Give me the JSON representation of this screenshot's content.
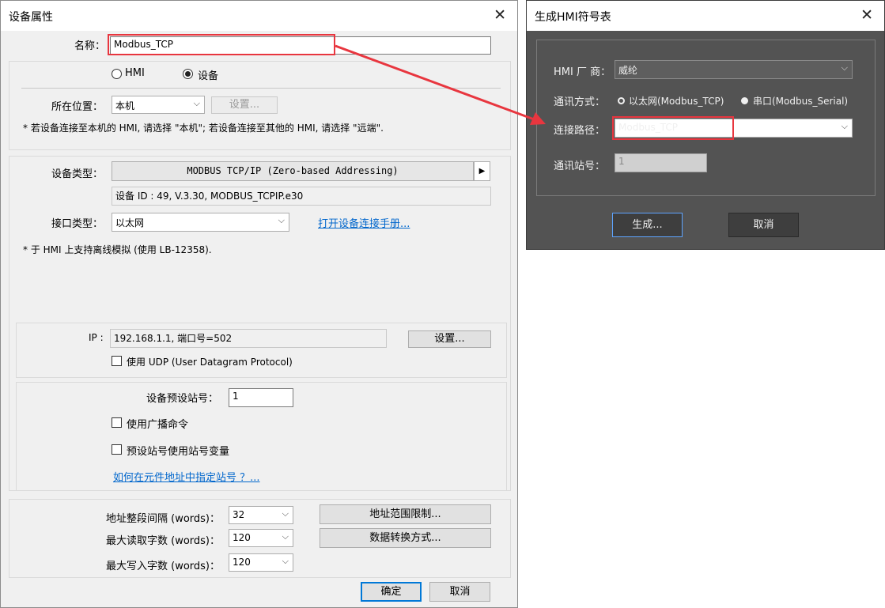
{
  "left_dialog": {
    "title": "设备属性",
    "name_label": "名称：",
    "name_value": "Modbus_TCP",
    "radio_hmi": "HMI",
    "radio_device": "设备",
    "location_label": "所在位置：",
    "location_value": "本机",
    "location_settings": "设置...",
    "location_note": "* 若设备连接至本机的 HMI, 请选择 \"本机\"; 若设备连接至其他的 HMI, 请选择 \"远端\".",
    "device_type_label": "设备类型：",
    "device_type_value": "MODBUS TCP/IP (Zero-based Addressing)",
    "device_id": "设备 ID : 49, V.3.30, MODBUS_TCPIP.e30",
    "interface_label": "接口类型：",
    "interface_value": "以太网",
    "manual_link": "打开设备连接手册...",
    "offline_note": "* 于 HMI 上支持离线模拟 (使用 LB-12358).",
    "ip_label": "IP :",
    "ip_value": "192.168.1.1,  端口号=502",
    "ip_settings": "设置...",
    "udp_label": "使用 UDP (User Datagram Protocol)",
    "station_label": "设备预设站号：",
    "station_value": "1",
    "broadcast_label": "使用广播命令",
    "station_var_label": "预设站号使用站号变量",
    "station_link": "如何在元件地址中指定站号 ？...",
    "interval_label": "地址整段间隔 (words)：",
    "interval_value": "32",
    "max_read_label": "最大读取字数 (words)：",
    "max_read_value": "120",
    "max_write_label": "最大写入字数 (words)：",
    "max_write_value": "120",
    "addr_limit_button": "地址范围限制...",
    "data_conv_button": "数据转换方式...",
    "ok": "确定",
    "cancel": "取消"
  },
  "right_dialog": {
    "title": "生成HMI符号表",
    "vendor_label": "HMI 厂 商：",
    "vendor_value": "威纶",
    "comm_label": "通讯方式：",
    "comm_ethernet": "以太网(Modbus_TCP)",
    "comm_serial": "串口(Modbus_Serial)",
    "path_label": "连接路径：",
    "path_value": "Modbus_TCP",
    "station_label": "通讯站号：",
    "station_value": "1",
    "generate": "生成...",
    "cancel": "取消"
  },
  "colors": {
    "highlight": "#e8363f",
    "dark_bg": "#535353",
    "link": "#0066cc"
  }
}
